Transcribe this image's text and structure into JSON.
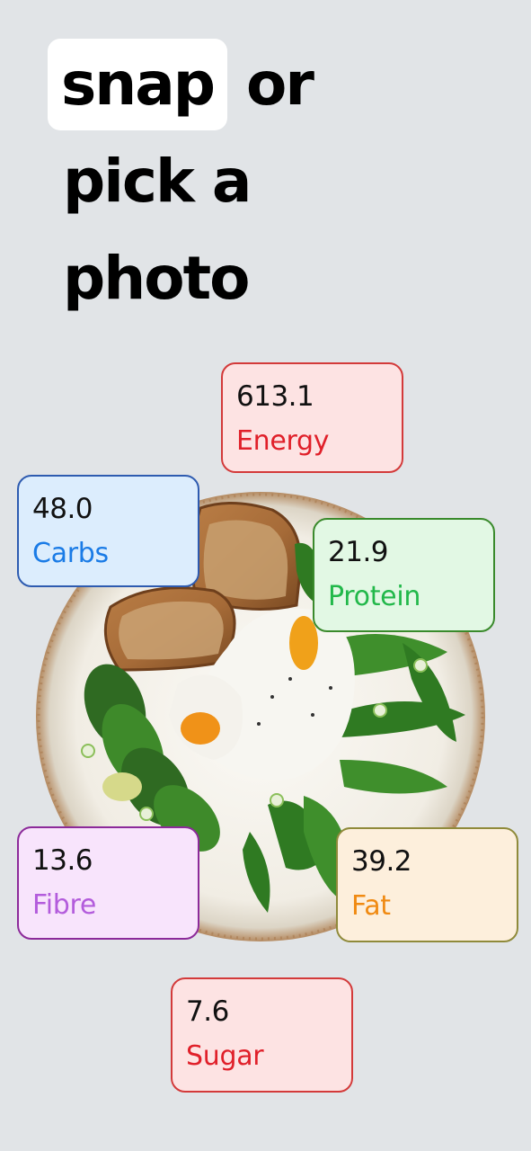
{
  "headline": {
    "highlight": "snap",
    "line1_rest": "or",
    "line2": "pick a",
    "line3": "photo"
  },
  "nutrients": [
    {
      "key": "energy",
      "value": "613.1",
      "label": "Energy",
      "bg": "#fde3e3",
      "border": "#d33a3a",
      "color": "#e0202a"
    },
    {
      "key": "carbs",
      "value": "48.0",
      "label": "Carbs",
      "bg": "#dcedfd",
      "border": "#2e5bb0",
      "color": "#1a7be6"
    },
    {
      "key": "protein",
      "value": "21.9",
      "label": "Protein",
      "bg": "#e2f8e4",
      "border": "#3a8a2c",
      "color": "#22b84a"
    },
    {
      "key": "fibre",
      "value": "13.6",
      "label": "Fibre",
      "bg": "#f8e4fc",
      "border": "#8c2a9a",
      "color": "#b35cdc"
    },
    {
      "key": "fat",
      "value": "39.2",
      "label": "Fat",
      "bg": "#fdefdc",
      "border": "#8f8a3a",
      "color": "#f08a12"
    },
    {
      "key": "sugar",
      "value": "7.6",
      "label": "Sugar",
      "bg": "#fde3e3",
      "border": "#d33a3a",
      "color": "#e0202a"
    }
  ]
}
